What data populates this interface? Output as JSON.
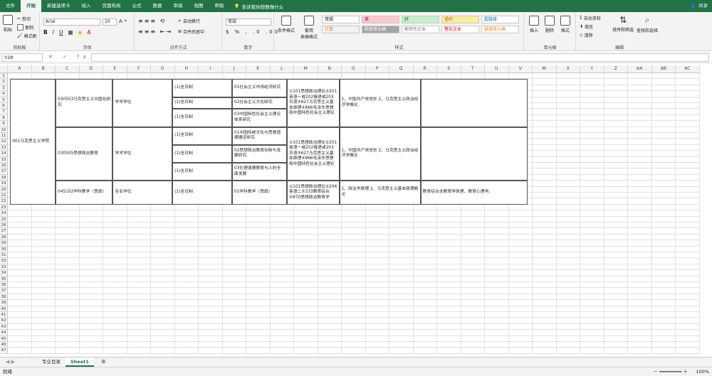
{
  "menu": {
    "tabs": [
      "文件",
      "开始",
      "新建选项卡",
      "插入",
      "页面布局",
      "公式",
      "数据",
      "审阅",
      "视图",
      "帮助"
    ],
    "active": "开始",
    "tell_me": "告诉我你想要做什么",
    "share": "共享"
  },
  "ribbon": {
    "clipboard": {
      "label": "剪贴板",
      "paste": "粘贴",
      "cut": "剪切",
      "copy": "复制",
      "format_painter": "格式刷"
    },
    "font": {
      "label": "字体",
      "name": "Arial",
      "size": "10"
    },
    "alignment": {
      "label": "对齐方式",
      "wrap": "自动换行",
      "merge": "合并后居中"
    },
    "number": {
      "label": "数字",
      "format": "常规"
    },
    "styles": {
      "label": "样式",
      "conditional": "条件格式",
      "table": "套用\n表格格式",
      "cells": [
        {
          "text": "常规",
          "bg": "#ffffff",
          "fg": "#000000"
        },
        {
          "text": "差",
          "bg": "#ffc7ce",
          "fg": "#9c0006"
        },
        {
          "text": "好",
          "bg": "#c6efce",
          "fg": "#006100"
        },
        {
          "text": "适中",
          "bg": "#ffeb9c",
          "fg": "#9c5700"
        },
        {
          "text": "超链接",
          "bg": "#ffffff",
          "fg": "#0563c1"
        },
        {
          "text": "计算",
          "bg": "#f2f2f2",
          "fg": "#fa7d00"
        },
        {
          "text": "检查单元格",
          "bg": "#a5a5a5",
          "fg": "#ffffff"
        },
        {
          "text": "解释性文本",
          "bg": "#ffffff",
          "fg": "#7f7f7f"
        },
        {
          "text": "警告文本",
          "bg": "#ffffff",
          "fg": "#ff0000"
        },
        {
          "text": "链接单元格",
          "bg": "#ffffff",
          "fg": "#fa7d00"
        }
      ]
    },
    "cells": {
      "label": "单元格",
      "insert": "插入",
      "delete": "删除",
      "format": "格式"
    },
    "editing": {
      "label": "编辑",
      "autosum": "自动求和",
      "fill": "填充",
      "clear": "清除",
      "sort": "排序和筛选",
      "find": "查找和选择"
    }
  },
  "formula_bar": {
    "name_box": "Y28",
    "fx": "✕ ✓ fx",
    "content": ""
  },
  "columns": [
    "A",
    "B",
    "C",
    "D",
    "E",
    "F",
    "G",
    "H",
    "I",
    "J",
    "K",
    "L",
    "M",
    "N",
    "O",
    "P",
    "Q",
    "R",
    "S",
    "T",
    "U",
    "V",
    "W",
    "X",
    "Y",
    "Z",
    "AA",
    "AB",
    "AC"
  ],
  "table": {
    "college": "001马克思主义学院",
    "majors": [
      {
        "code": "030503马克思主义中国化研究",
        "type": "学术学位"
      },
      {
        "code": "030505思想政治教育",
        "type": "学术学位"
      },
      {
        "code": "045102学科教学（思政）",
        "type": "专业学位"
      }
    ],
    "modes": [
      "(1)全日制",
      "(1)全日制",
      "(1)全日制",
      "(1)全日制",
      "(1)全日制",
      "(1)全日制",
      "(1)全日制"
    ],
    "directions": [
      "01社会主义市场经济研究",
      "02社会主义文化研究",
      "03中国特色社会主义理论体系研究",
      "01中国传统文化与思想道德建设研究",
      "02思想政治教育创新与发展研究",
      "03伦理道德教育与人的全面发展",
      "01学科教学（思政）"
    ],
    "exams": [
      "①101思想政治理论②201英语一或202俄语或203日语③627马克思主义基本原理④866毛泽东思想和中国特色社会主义理论",
      "①101思想政治理论②201英语一或202俄语或203日语③627马克思主义基本原理④866毛泽东思想和中国特色社会主义理论",
      "①101思想政治理论②204英语二③333教育综合④870思想政治教育学"
    ],
    "retests": [
      "1、中国共产党党史 2、马克思主义政治经济学概论",
      "1、中国共产党党史 2、马克思主义政治经济学概论",
      "1、政治学原理 2、马克思主义基本原理概论"
    ],
    "extra": "教育综合含教育学原理、教育心理学。"
  },
  "sheets": [
    "专业目录",
    "Sheet1"
  ],
  "active_sheet": "Sheet1",
  "status": {
    "ready": "就绪",
    "zoom": "100%"
  }
}
